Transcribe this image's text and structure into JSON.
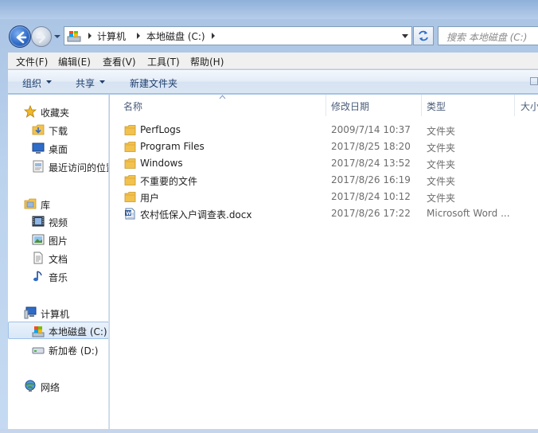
{
  "address": {
    "breadcrumbs": [
      "计算机",
      "本地磁盘 (C:)"
    ]
  },
  "search": {
    "placeholder": "搜索 本地磁盘 (C:)"
  },
  "menu": [
    "文件(F)",
    "编辑(E)",
    "查看(V)",
    "工具(T)",
    "帮助(H)"
  ],
  "commands": {
    "organize": "组织",
    "share": "共享",
    "new_folder": "新建文件夹"
  },
  "sidebar": {
    "favorites": {
      "label": "收藏夹",
      "items": [
        "下载",
        "桌面",
        "最近访问的位置"
      ]
    },
    "libraries": {
      "label": "库",
      "items": [
        "视频",
        "图片",
        "文档",
        "音乐"
      ]
    },
    "computer": {
      "label": "计算机",
      "items": [
        "本地磁盘 (C:)",
        "新加卷 (D:)"
      ]
    },
    "network": {
      "label": "网络"
    }
  },
  "columns": {
    "name": "名称",
    "date": "修改日期",
    "type": "类型",
    "size": "大小"
  },
  "files": [
    {
      "name": "PerfLogs",
      "date": "2009/7/14 10:37",
      "type": "文件夹",
      "icon": "folder-icon"
    },
    {
      "name": "Program Files",
      "date": "2017/8/25 18:20",
      "type": "文件夹",
      "icon": "folder-icon"
    },
    {
      "name": "Windows",
      "date": "2017/8/24 13:52",
      "type": "文件夹",
      "icon": "folder-icon"
    },
    {
      "name": "不重要的文件",
      "date": "2017/8/26 16:19",
      "type": "文件夹",
      "icon": "folder-icon"
    },
    {
      "name": "用户",
      "date": "2017/8/24 10:12",
      "type": "文件夹",
      "icon": "folder-icon"
    },
    {
      "name": "农村低保入户调查表.docx",
      "date": "2017/8/26 17:22",
      "type": "Microsoft Word ...",
      "icon": "word-doc-icon"
    }
  ],
  "colors": {
    "folder": "#f2c24e",
    "selection": "#d8e7f8",
    "header_text": "#4a5d7a",
    "frame": "#bcd3ee"
  }
}
